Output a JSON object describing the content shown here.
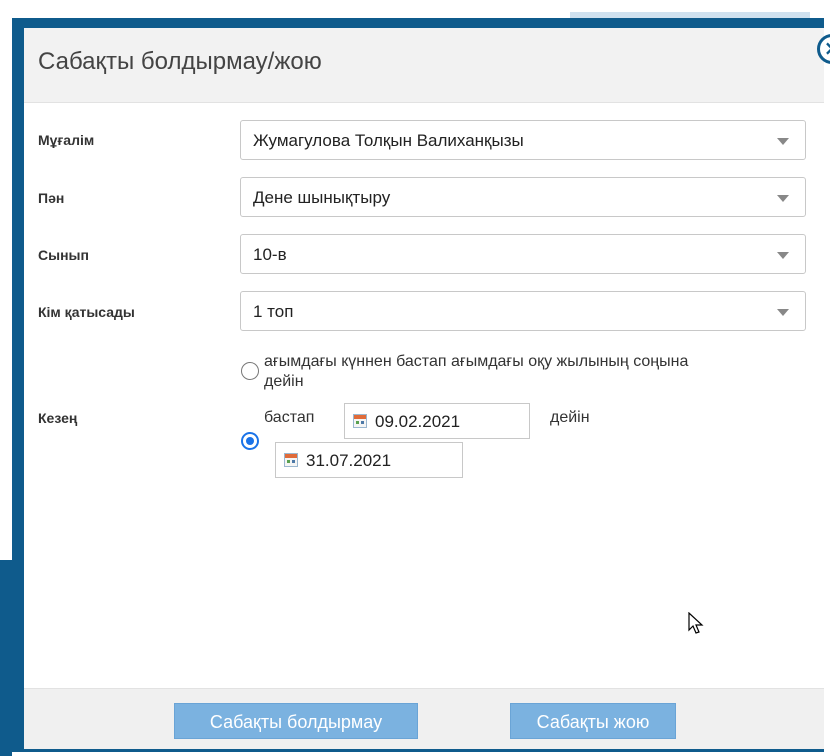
{
  "dialog": {
    "title": "Сабақты болдырмау/жою",
    "close_glyph": "×"
  },
  "fields": {
    "teacher": {
      "label": "Мұғалім",
      "value": "Жумагулова Толқын Валиханқызы"
    },
    "subject": {
      "label": "Пән",
      "value": "Дене шынықтыру"
    },
    "class": {
      "label": "Сынып",
      "value": "10-в"
    },
    "participants": {
      "label": "Кім қатысады",
      "value": "1 топ"
    }
  },
  "period": {
    "label": "Кезең",
    "option_current_line1": "ағымдағы күннен бастап ағымдағы оқу жылының соңына",
    "option_current_line2": "дейін",
    "option_range_from_label": "бастап",
    "option_range_to_label": "дейін",
    "date_from": "09.02.2021",
    "date_to": "31.07.2021",
    "selected": "range"
  },
  "footer": {
    "cancel_lesson_label": "Сабақты болдырмау",
    "delete_lesson_label": "Сабақты жою"
  },
  "colors": {
    "dialog_border": "#0f5b8c",
    "button_bg": "#7bb2e0",
    "radio_selected": "#1a73e8"
  }
}
